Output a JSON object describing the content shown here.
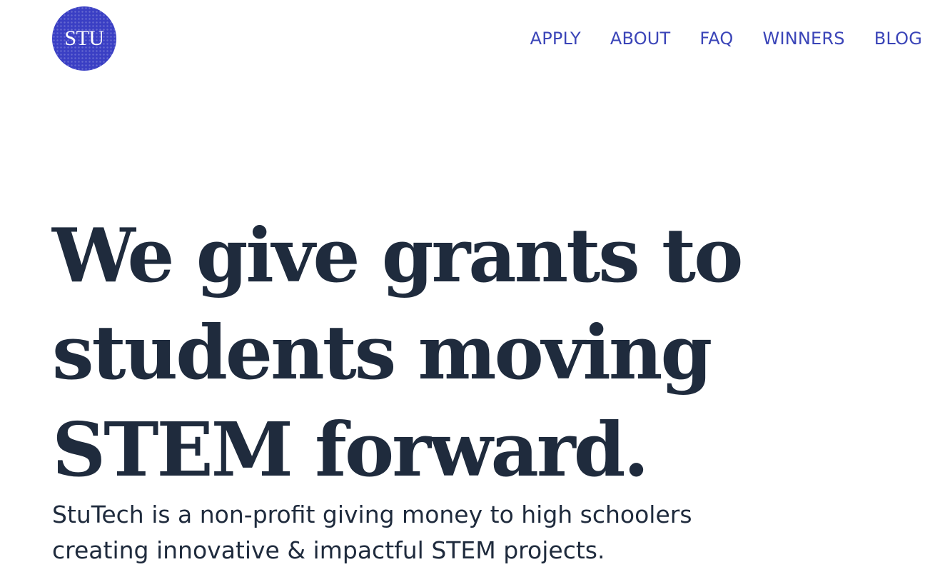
{
  "header": {
    "logo_text": "STU",
    "nav": [
      {
        "label": "APPLY"
      },
      {
        "label": "ABOUT"
      },
      {
        "label": "FAQ"
      },
      {
        "label": "WINNERS"
      },
      {
        "label": "BLOG"
      }
    ]
  },
  "hero": {
    "headline_lines": [
      "We give grants to",
      "students moving",
      "STEM forward."
    ],
    "subtitle_lines": [
      "StuTech is a non-profit giving money to high schoolers",
      "creating innovative & impactful STEM projects."
    ]
  },
  "colors": {
    "accent": "#3b45b8",
    "logo_bg": "#3a3fc4",
    "text": "#1f2b3d",
    "background": "#ffffff"
  }
}
